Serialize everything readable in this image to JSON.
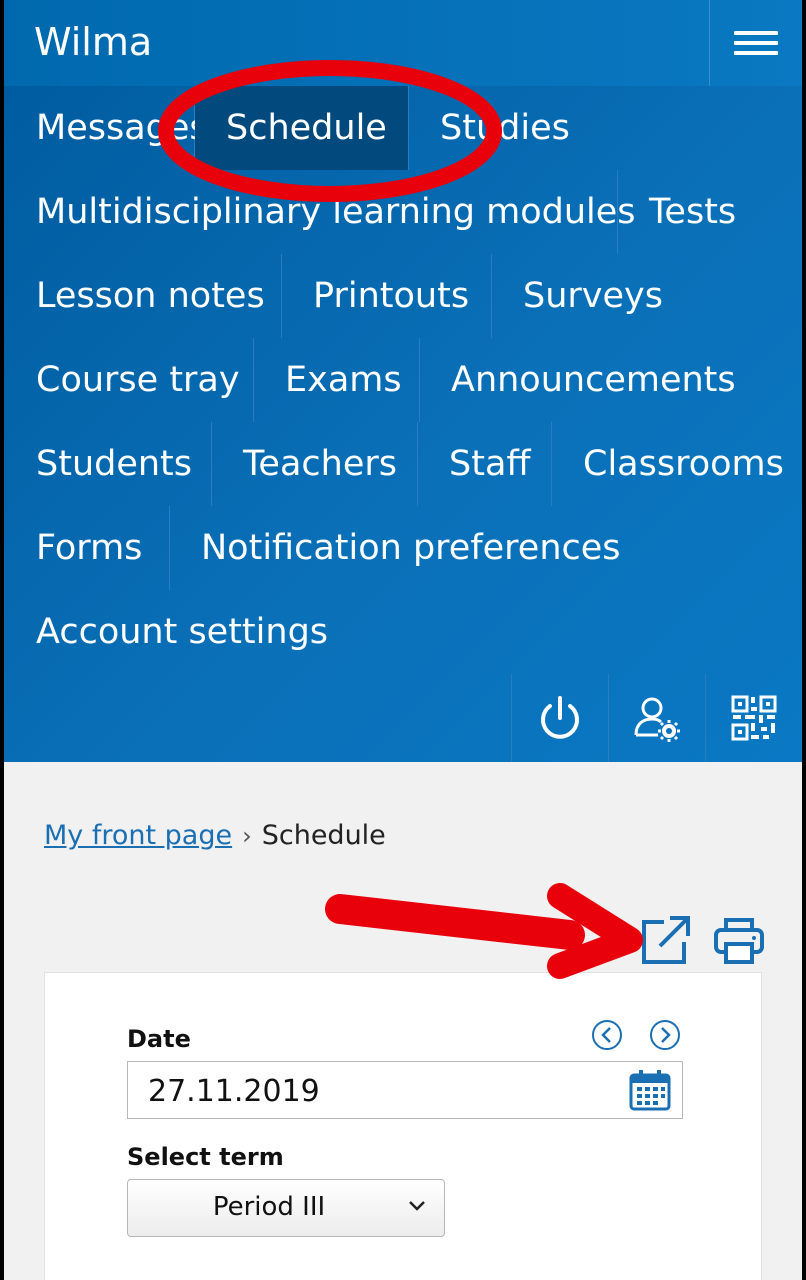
{
  "app": {
    "title": "Wilma"
  },
  "nav": {
    "rows": [
      [
        "Messages",
        "Schedule",
        "Studies"
      ],
      [
        "Multidisciplinary learning modules",
        "Tests"
      ],
      [
        "Lesson notes",
        "Printouts",
        "Surveys"
      ],
      [
        "Course tray",
        "Exams",
        "Announcements"
      ],
      [
        "Students",
        "Teachers",
        "Staff",
        "Classrooms"
      ],
      [
        "Forms",
        "Notification preferences"
      ],
      [
        "Account settings"
      ]
    ],
    "active": "Schedule",
    "icons": [
      "power-icon",
      "user-settings-icon",
      "qr-code-icon"
    ]
  },
  "breadcrumb": {
    "home": "My front page",
    "separator": "›",
    "current": "Schedule"
  },
  "toolbar": {
    "icons": [
      "open-external-icon",
      "print-icon"
    ]
  },
  "form": {
    "date_label": "Date",
    "date_value": "27.11.2019",
    "term_label": "Select term",
    "term_selected": "Period III"
  },
  "colors": {
    "nav_bg": "#0069ae",
    "active_item": "#024a7e",
    "link": "#1a6fb3",
    "annotation": "#e8000b"
  }
}
